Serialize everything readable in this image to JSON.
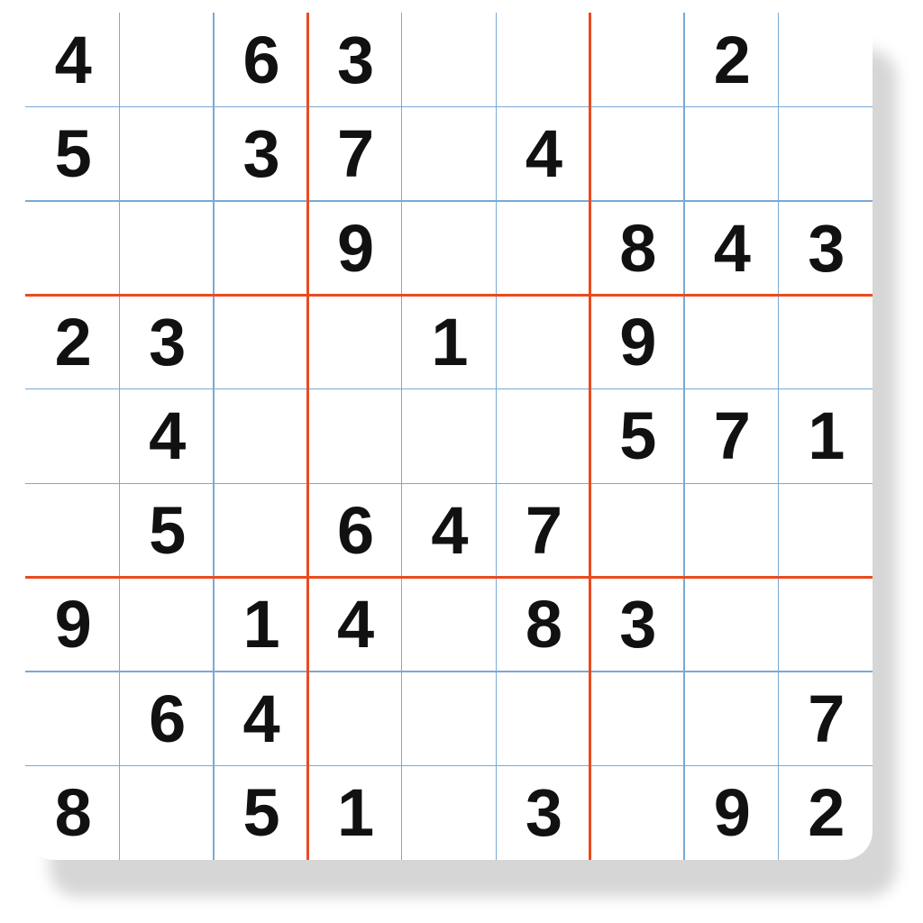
{
  "sudoku": {
    "grid_size": 9,
    "colors": {
      "thin_line": "#79a9d6",
      "thick_line": "#ea4b1f",
      "digit": "#111111",
      "board_bg": "#ffffff"
    },
    "cells": [
      [
        "4",
        "",
        "6",
        "3",
        "",
        "",
        "",
        "2",
        ""
      ],
      [
        "5",
        "",
        "3",
        "7",
        "",
        "4",
        "",
        "",
        ""
      ],
      [
        "",
        "",
        "",
        "9",
        "",
        "",
        "8",
        "4",
        "3"
      ],
      [
        "2",
        "3",
        "",
        "",
        "1",
        "",
        "9",
        "",
        ""
      ],
      [
        "",
        "4",
        "",
        "",
        "",
        "",
        "5",
        "7",
        "1"
      ],
      [
        "",
        "5",
        "",
        "6",
        "4",
        "7",
        "",
        "",
        ""
      ],
      [
        "9",
        "",
        "1",
        "4",
        "",
        "8",
        "3",
        "",
        ""
      ],
      [
        "",
        "6",
        "4",
        "",
        "",
        "",
        "",
        "",
        "7"
      ],
      [
        "8",
        "",
        "5",
        "1",
        "",
        "3",
        "",
        "9",
        "2"
      ]
    ]
  }
}
